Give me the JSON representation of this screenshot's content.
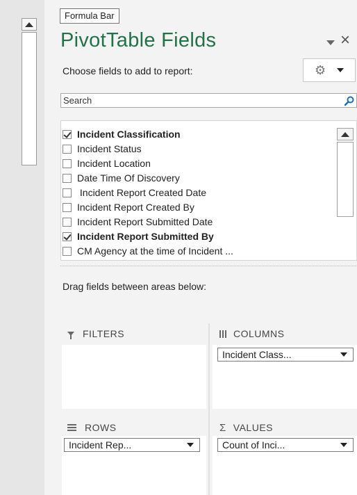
{
  "tooltip": "Formula Bar",
  "pane": {
    "title": "PivotTable Fields",
    "choose_label": "Choose fields to add to report:",
    "search_placeholder": "Search",
    "drag_label": "Drag fields between areas below:",
    "accent_color": "#217346"
  },
  "fields": [
    {
      "label": "Incident Classification",
      "checked": true
    },
    {
      "label": "Incident Status",
      "checked": false
    },
    {
      "label": "Incident Location",
      "checked": false
    },
    {
      "label": "Date Time Of Discovery",
      "checked": false
    },
    {
      "label": " Incident Report Created Date",
      "checked": false
    },
    {
      "label": "Incident Report Created By",
      "checked": false
    },
    {
      "label": "Incident Report Submitted Date",
      "checked": false
    },
    {
      "label": "Incident Report Submitted By",
      "checked": true
    },
    {
      "label": "CM Agency at the time of Incident ...",
      "checked": false
    }
  ],
  "areas": {
    "filters": {
      "label": "FILTERS",
      "icon": "filter-icon"
    },
    "columns": {
      "label": "COLUMNS",
      "icon": "columns-icon",
      "chip": "Incident Class..."
    },
    "rows": {
      "label": "ROWS",
      "icon": "rows-icon",
      "chip": "Incident Rep..."
    },
    "values": {
      "label": "VALUES",
      "icon": "sigma-icon",
      "chip": "Count of Inci..."
    }
  },
  "icons": {
    "gear": "⚙",
    "close": "×",
    "sigma": "Σ"
  }
}
